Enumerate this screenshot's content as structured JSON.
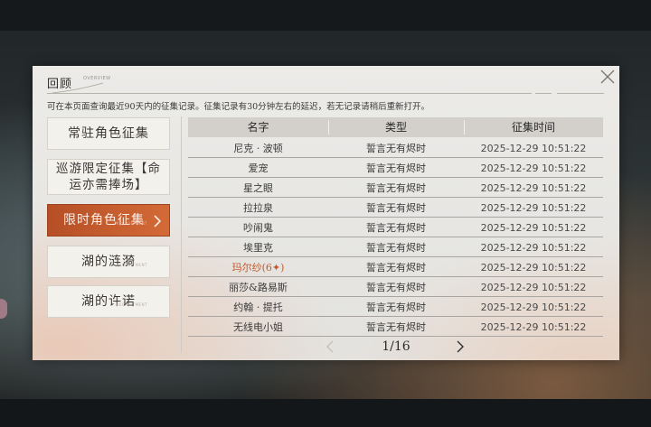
{
  "dialog": {
    "title": "回顾",
    "title_deco": "OVERVIEW",
    "notice": "可在本页面查询最近90天内的征集记录。征集记录有30分钟左右的延迟，若无记录请稍后重新打开。"
  },
  "categories": [
    {
      "label": "常驻角色征集",
      "active": false
    },
    {
      "label": "巡游限定征集【命运亦需捧场】",
      "active": false
    },
    {
      "label": "限时角色征集",
      "active": true
    },
    {
      "label": "湖的涟漪",
      "active": false
    },
    {
      "label": "湖的许诺",
      "active": false
    }
  ],
  "category_deco": "RECRUITMENT",
  "table": {
    "headers": {
      "name": "名字",
      "type": "类型",
      "time": "征集时间"
    },
    "rows": [
      {
        "name": "尼克 · 波顿",
        "type": "誓言无有烬时",
        "time": "2025-12-29 10:51:22",
        "highlight": false
      },
      {
        "name": "爱宠",
        "type": "誓言无有烬时",
        "time": "2025-12-29 10:51:22",
        "highlight": false
      },
      {
        "name": "星之眼",
        "type": "誓言无有烬时",
        "time": "2025-12-29 10:51:22",
        "highlight": false
      },
      {
        "name": "拉拉泉",
        "type": "誓言无有烬时",
        "time": "2025-12-29 10:51:22",
        "highlight": false
      },
      {
        "name": "吵闹鬼",
        "type": "誓言无有烬时",
        "time": "2025-12-29 10:51:22",
        "highlight": false
      },
      {
        "name": "埃里克",
        "type": "誓言无有烬时",
        "time": "2025-12-29 10:51:22",
        "highlight": false
      },
      {
        "name": "玛尔纱(6✦)",
        "type": "誓言无有烬时",
        "time": "2025-12-29 10:51:22",
        "highlight": true
      },
      {
        "name": "丽莎&路易斯",
        "type": "誓言无有烬时",
        "time": "2025-12-29 10:51:22",
        "highlight": false
      },
      {
        "name": "约翰 · 提托",
        "type": "誓言无有烬时",
        "time": "2025-12-29 10:51:22",
        "highlight": false
      },
      {
        "name": "无线电小姐",
        "type": "誓言无有烬时",
        "time": "2025-12-29 10:51:22",
        "highlight": false
      }
    ]
  },
  "pagination": {
    "text": "1/16"
  },
  "colors": {
    "accent": "#c7602f",
    "highlight_text": "#c15a2b"
  },
  "icons": {
    "close": "close-icon",
    "prev": "chevron-left-icon",
    "next": "chevron-right-icon",
    "active_arrow": "chevron-right-icon"
  }
}
